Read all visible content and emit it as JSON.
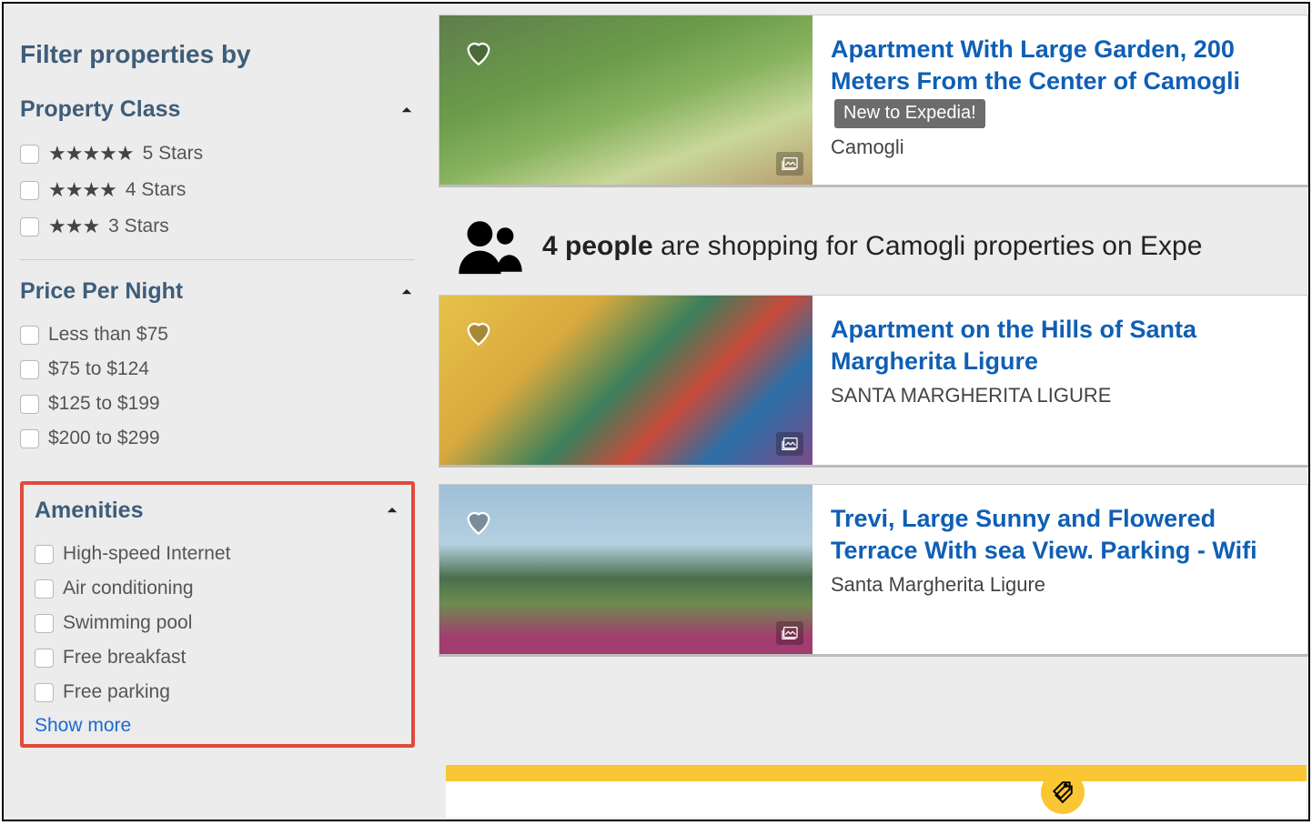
{
  "sidebar": {
    "title": "Filter properties by",
    "property_class": {
      "heading": "Property Class",
      "options": [
        {
          "stars": "★★★★★",
          "label": "5 Stars"
        },
        {
          "stars": "★★★★",
          "label": "4 Stars"
        },
        {
          "stars": "★★★",
          "label": "3 Stars"
        }
      ]
    },
    "price": {
      "heading": "Price Per Night",
      "options": [
        "Less than $75",
        "$75 to $124",
        "$125 to $199",
        "$200 to $299"
      ]
    },
    "amenities": {
      "heading": "Amenities",
      "options": [
        "High-speed Internet",
        "Air conditioning",
        "Swimming pool",
        "Free breakfast",
        "Free parking"
      ],
      "show_more": "Show more"
    }
  },
  "banner": {
    "count_text": "4 people",
    "rest_text": " are shopping for Camogli properties on Expe"
  },
  "listings": [
    {
      "title": "Apartment With Large Garden, 200 Meters From the Center of Camogli",
      "badge": "New to Expedia!",
      "location": "Camogli",
      "img_class": "img1"
    },
    {
      "title": "Apartment on the Hills of Santa Margherita Ligure",
      "badge": "",
      "location": "SANTA MARGHERITA LIGURE",
      "img_class": "img2"
    },
    {
      "title": "Trevi, Large Sunny and Flowered Terrace With sea View. Parking - Wifi",
      "badge": "",
      "location": "Santa Margherita Ligure",
      "img_class": "img3"
    }
  ]
}
